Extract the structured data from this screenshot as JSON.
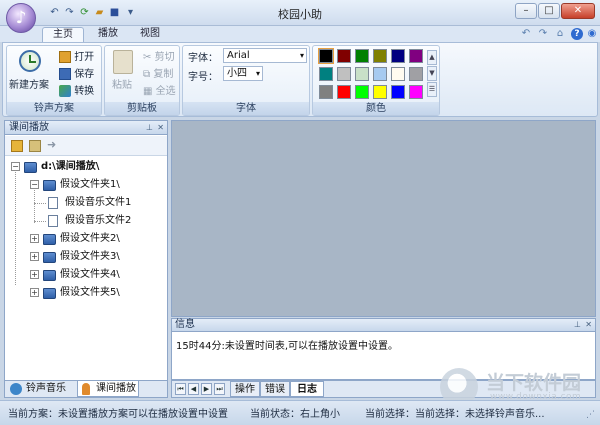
{
  "app": {
    "title": "校园小助"
  },
  "tabs": [
    {
      "label": "主页"
    },
    {
      "label": "播放"
    },
    {
      "label": "视图"
    }
  ],
  "ribbon": {
    "groups": {
      "scheme": {
        "label": "铃声方案",
        "new_label": "新建方案",
        "open_label": "打开",
        "save_label": "保存",
        "convert_label": "转换"
      },
      "clipboard": {
        "label": "剪贴板",
        "paste_label": "粘贴",
        "cut_label": "剪切",
        "copy_label": "复制",
        "selectall_label": "全选"
      },
      "font": {
        "label": "字体",
        "font_label": "字体：",
        "font_value": "Arial",
        "size_label": "字号：",
        "size_value": "小四"
      },
      "color": {
        "label": "颜色",
        "swatches": [
          "#000000",
          "#800000",
          "#008000",
          "#808000",
          "#000080",
          "#800080",
          "#008080",
          "#c0c0c0",
          "#c8e0c8",
          "#a6caf0",
          "#fffbf0",
          "#a0a0a4",
          "#808080",
          "#ff0000",
          "#00ff00",
          "#ffff00",
          "#0000ff",
          "#ff00ff"
        ]
      }
    }
  },
  "left_panel": {
    "title": "课间播放",
    "tree": [
      {
        "label": "d:\\课间播放\\",
        "level": 0,
        "type": "root",
        "expanded": true
      },
      {
        "label": "假设文件夹1\\",
        "level": 1,
        "type": "folder",
        "expanded": true
      },
      {
        "label": "假设音乐文件1",
        "level": 2,
        "type": "file"
      },
      {
        "label": "假设音乐文件2",
        "level": 2,
        "type": "file"
      },
      {
        "label": "假设文件夹2\\",
        "level": 1,
        "type": "folder",
        "expanded": false
      },
      {
        "label": "假设文件夹3\\",
        "level": 1,
        "type": "folder",
        "expanded": false
      },
      {
        "label": "假设文件夹4\\",
        "level": 1,
        "type": "folder",
        "expanded": false
      },
      {
        "label": "假设文件夹5\\",
        "level": 1,
        "type": "folder",
        "expanded": false
      }
    ],
    "bottom_tabs": [
      {
        "label": "铃声音乐"
      },
      {
        "label": "课间播放"
      }
    ]
  },
  "info_panel": {
    "title": "信息",
    "message": "15时44分:未设置时间表,可以在播放设置中设置。",
    "tabs": [
      {
        "label": "操作"
      },
      {
        "label": "错误"
      },
      {
        "label": "日志"
      }
    ]
  },
  "status_bar": {
    "scheme": "当前方案：未设置播放方案可以在播放设置中设置",
    "state": "当前状态：右上角小",
    "selection": "当前选择：当前选择：未选择铃声音乐..."
  },
  "watermark": {
    "name": "当下软件园",
    "url": "www.downxia.com"
  }
}
